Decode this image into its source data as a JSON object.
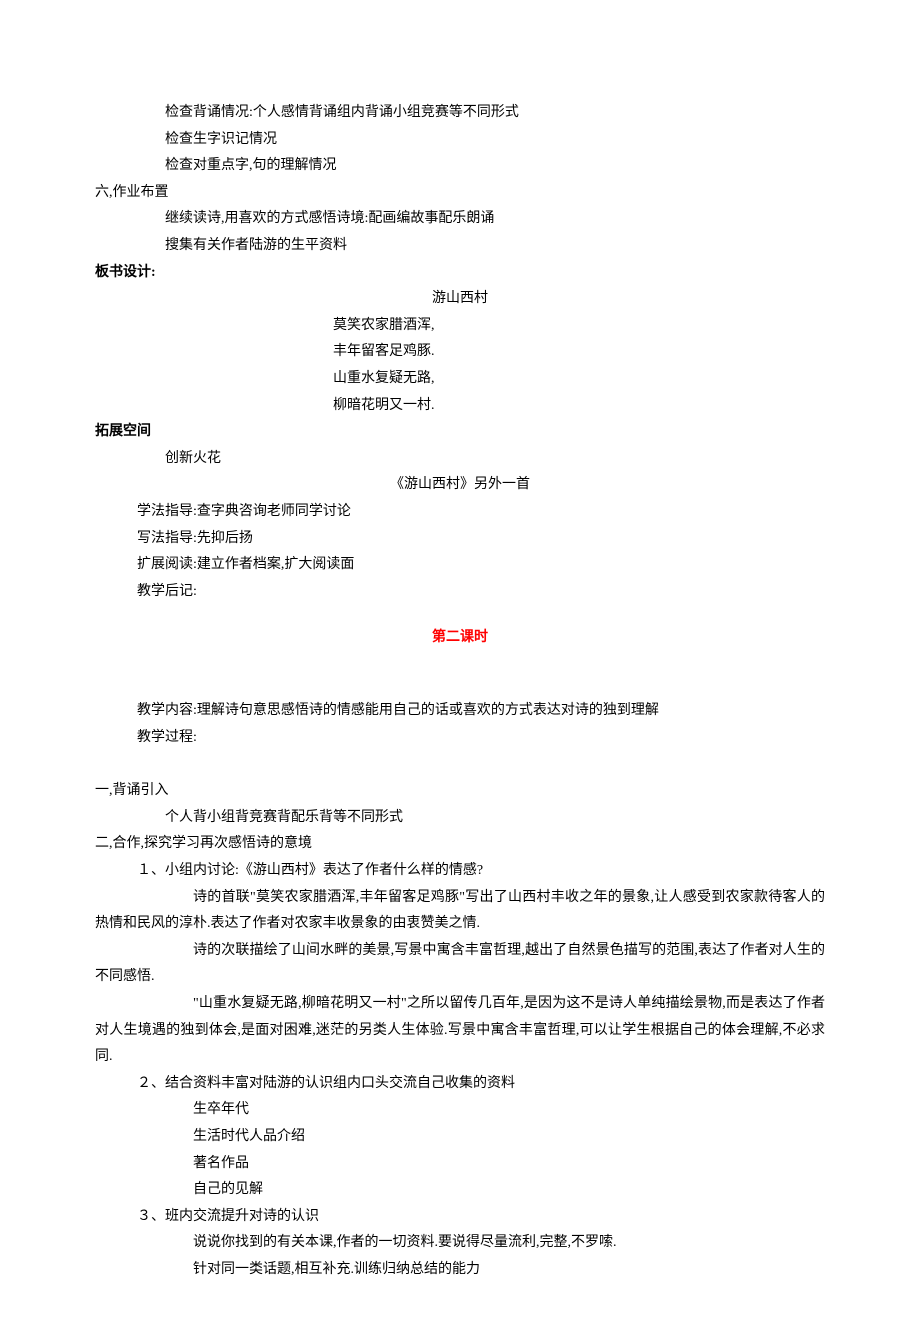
{
  "lines": {
    "l1": "检查背诵情况:个人感情背诵组内背诵小组竞赛等不同形式",
    "l2": "检查生字识记情况",
    "l3": "检查对重点字,句的理解情况",
    "l4": "六,作业布置",
    "l5": "继续读诗,用喜欢的方式感悟诗境:配画编故事配乐朗诵",
    "l6": "搜集有关作者陆游的生平资料",
    "l7": "板书设计:",
    "poem_title": "游山西村",
    "p1": "莫笑农家腊酒浑,",
    "p2": "丰年留客足鸡豚.",
    "p3": "山重水复疑无路,",
    "p4": "柳暗花明又一村.",
    "l8": "拓展空间",
    "l9": "创新火花",
    "l10": "《游山西村》另外一首",
    "l11": "学法指导:查字典咨询老师同学讨论",
    "l12": "写法指导:先抑后扬",
    "l13": "扩展阅读:建立作者档案,扩大阅读面",
    "l14": "教学后记:",
    "section2": "第二课时",
    "l15": "教学内容:理解诗句意思感悟诗的情感能用自己的话或喜欢的方式表达对诗的独到理解",
    "l16": "教学过程:",
    "l17": "一,背诵引入",
    "l18": "个人背小组背竞赛背配乐背等不同形式",
    "l19": "二,合作,探究学习再次感悟诗的意境",
    "l20": "１、小组内讨论:《游山西村》表达了作者什么样的情感?",
    "l21": "诗的首联\"莫笑农家腊酒浑,丰年留客足鸡豚\"写出了山西村丰收之年的景象,让人感受到农家款待客人的热情和民风的淳朴.表达了作者对农家丰收景象的由衷赞美之情.",
    "l22": "诗的次联描绘了山间水畔的美景,写景中寓含丰富哲理,越出了自然景色描写的范围,表达了作者对人生的不同感悟.",
    "l23": "\"山重水复疑无路,柳暗花明又一村\"之所以留传几百年,是因为这不是诗人单纯描绘景物,而是表达了作者对人生境遇的独到体会,是面对困难,迷茫的另类人生体验.写景中寓含丰富哲理,可以让学生根据自己的体会理解,不必求同.",
    "l24": "２、结合资料丰富对陆游的认识组内口头交流自己收集的资料",
    "l25": "生卒年代",
    "l26": "生活时代人品介绍",
    "l27": "著名作品",
    "l28": "自己的见解",
    "l29": "３、班内交流提升对诗的认识",
    "l30": "说说你找到的有关本课,作者的一切资料.要说得尽量流利,完整,不罗嗦.",
    "l31": "针对同一类话题,相互补充.训练归纳总结的能力"
  }
}
